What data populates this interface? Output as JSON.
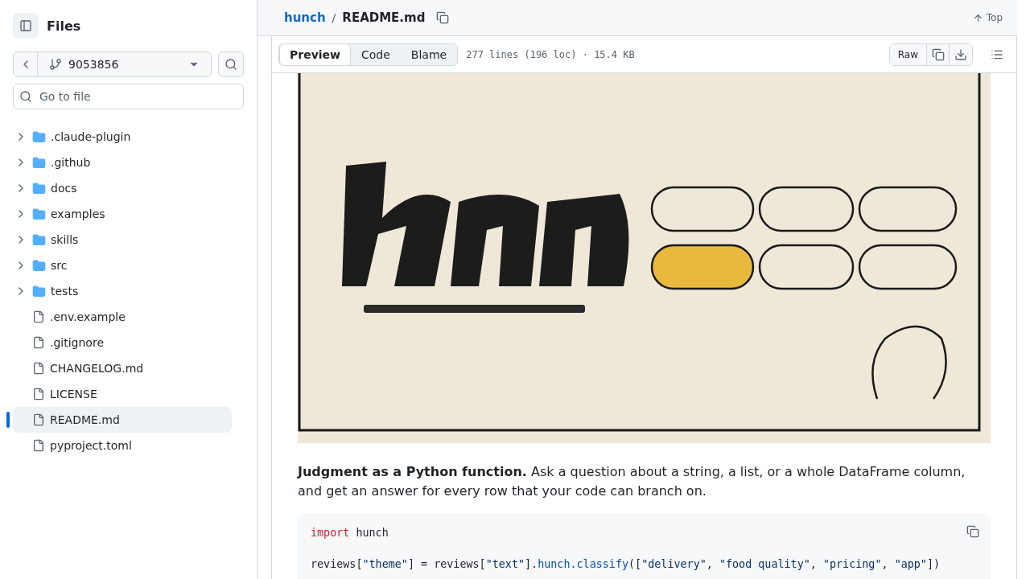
{
  "sidebar": {
    "title": "Files",
    "branch": "9053856",
    "search": {
      "placeholder": "Go to file"
    },
    "items": [
      {
        "kind": "folder",
        "name": ".claude-plugin",
        "expanded": false,
        "selected": false
      },
      {
        "kind": "folder",
        "name": ".github",
        "expanded": false,
        "selected": false
      },
      {
        "kind": "folder",
        "name": "docs",
        "expanded": false,
        "selected": false
      },
      {
        "kind": "folder",
        "name": "examples",
        "expanded": false,
        "selected": false
      },
      {
        "kind": "folder",
        "name": "skills",
        "expanded": false,
        "selected": false
      },
      {
        "kind": "folder",
        "name": "src",
        "expanded": false,
        "selected": false
      },
      {
        "kind": "folder",
        "name": "tests",
        "expanded": false,
        "selected": false
      },
      {
        "kind": "file",
        "name": ".env.example",
        "selected": false
      },
      {
        "kind": "file",
        "name": ".gitignore",
        "selected": false
      },
      {
        "kind": "file",
        "name": "CHANGELOG.md",
        "selected": false
      },
      {
        "kind": "file",
        "name": "LICENSE",
        "selected": false
      },
      {
        "kind": "file",
        "name": "README.md",
        "selected": true
      },
      {
        "kind": "file",
        "name": "pyproject.toml",
        "selected": false
      }
    ]
  },
  "breadcrumb": {
    "repo": "hunch",
    "separator": "/",
    "file": "README.md"
  },
  "top_link": "Top",
  "view_tabs": [
    {
      "label": "Preview",
      "selected": true
    },
    {
      "label": "Code",
      "selected": false
    },
    {
      "label": "Blame",
      "selected": false
    }
  ],
  "file_info": "277 lines (196 loc) · 15.4 KB",
  "raw_button": "Raw",
  "readme": {
    "intro": "**Judgment as a Python function.** Ask a question about a string, a list, or a whole DataFrame column, and get an answer for every row that your code can branch on.",
    "code": [
      {
        "kind": "tokens",
        "tokens": [
          {
            "kind": "keyword",
            "text": "import"
          },
          {
            "kind": "plain",
            "text": " hunch"
          }
        ]
      },
      {
        "kind": "blank"
      },
      {
        "kind": "tokens",
        "tokens": [
          {
            "kind": "plain",
            "text": "reviews["
          },
          {
            "kind": "string",
            "text": "\"theme\""
          },
          {
            "kind": "plain",
            "text": "] = reviews["
          },
          {
            "kind": "string",
            "text": "\"text\""
          },
          {
            "kind": "plain",
            "text": "]."
          },
          {
            "kind": "func",
            "text": "hunch.classify"
          },
          {
            "kind": "plain",
            "text": "(["
          },
          {
            "kind": "string",
            "text": "\"delivery\""
          },
          {
            "kind": "plain",
            "text": ", "
          },
          {
            "kind": "string",
            "text": "\"food quality\""
          },
          {
            "kind": "plain",
            "text": ", "
          },
          {
            "kind": "string",
            "text": "\"pricing\""
          },
          {
            "kind": "plain",
            "text": ", "
          },
          {
            "kind": "string",
            "text": "\"app\""
          },
          {
            "kind": "plain",
            "text": "])"
          }
        ]
      }
    ]
  }
}
